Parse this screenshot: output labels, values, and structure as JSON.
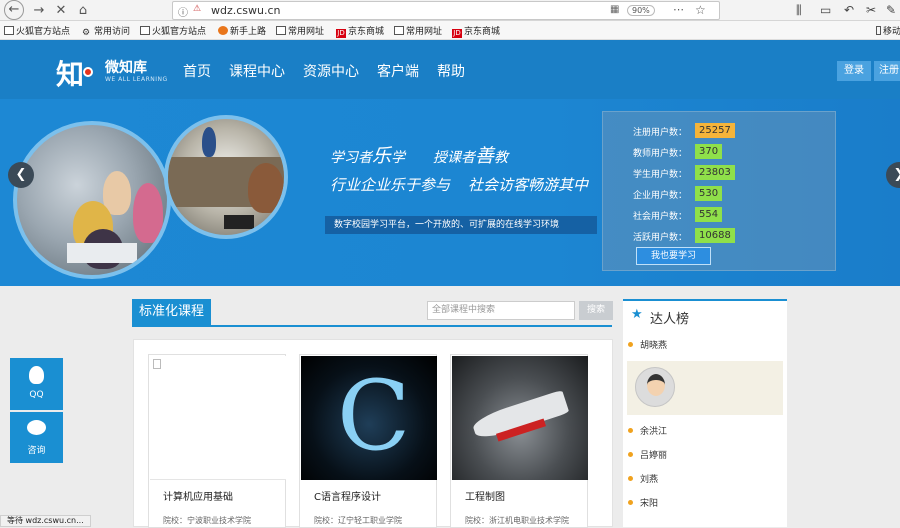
{
  "browser": {
    "url": "wdz.cswu.cn",
    "zoom": "90%",
    "status": "等待 wdz.cswu.cn..."
  },
  "bookmarks": [
    "火狐官方站点",
    "常用访问",
    "火狐官方站点",
    "新手上路",
    "常用网址",
    "京东商城",
    "常用网址",
    "京东商城",
    "移动"
  ],
  "site": {
    "logo_title": "微知库",
    "logo_sub": "WE ALL LEARNING",
    "nav": [
      "首页",
      "课程中心",
      "资源中心",
      "客户端",
      "帮助"
    ],
    "login": "登录",
    "register": "注册"
  },
  "banner": {
    "slogan1_a": "学习者",
    "slogan1_b": "乐",
    "slogan1_c": "学",
    "slogan2_a": "授课者",
    "slogan2_b": "善",
    "slogan2_c": "教",
    "slogan3": "行业企业乐于参与",
    "slogan4": "社会访客畅游其中",
    "tagline": "数字校园学习平台，一个开放的、可扩展的在线学习环境",
    "stats": [
      {
        "label": "注册用户数：",
        "value": "25257",
        "color": "#f5b43a"
      },
      {
        "label": "教师用户数：",
        "value": "370",
        "color": "#8fe04a"
      },
      {
        "label": "学生用户数：",
        "value": "23803",
        "color": "#8fe04a"
      },
      {
        "label": "企业用户数：",
        "value": "530",
        "color": "#8fe04a"
      },
      {
        "label": "社会用户数：",
        "value": "554",
        "color": "#8fe04a"
      },
      {
        "label": "活跃用户数：",
        "value": "10688",
        "color": "#8fe04a"
      }
    ],
    "button": "我也要学习"
  },
  "courses": {
    "tab": "标准化课程",
    "search_placeholder": "全部课程中搜索",
    "search_button": "搜索",
    "items": [
      {
        "name": "计算机应用基础",
        "org": "院校：宁波职业技术学院"
      },
      {
        "name": "C语言程序设计",
        "org": "院校：辽宁轻工职业学院"
      },
      {
        "name": "工程制图",
        "org": "院校：浙江机电职业技术学院"
      }
    ]
  },
  "sidebar": {
    "title": "达人榜",
    "items": [
      "胡晓燕",
      "余洪江",
      "吕婷丽",
      "刘燕",
      "宋阳"
    ]
  },
  "float": {
    "qq": "QQ",
    "consult": "咨询"
  }
}
